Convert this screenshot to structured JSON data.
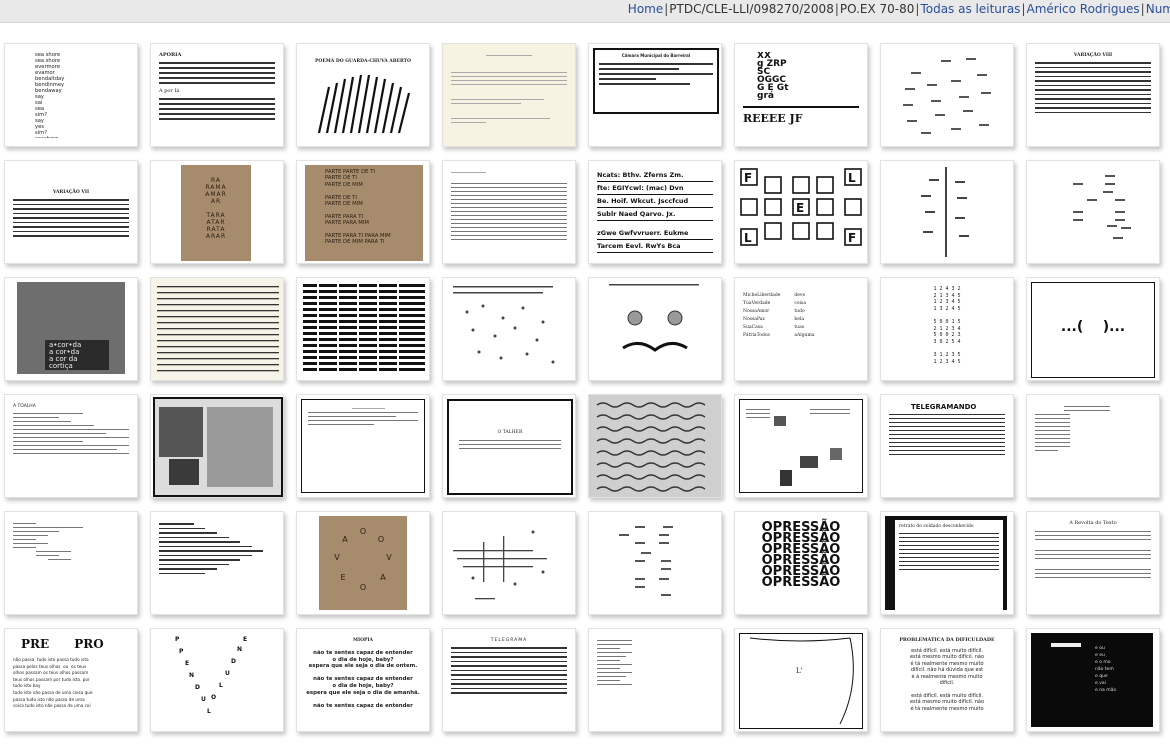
{
  "breadcrumb": {
    "home": "Home",
    "project": "PTDC/CLE-LLI/098270/2008",
    "section": "PO.EX 70-80",
    "all_readings": "Todas as leituras",
    "author": "Américo Rodrigues",
    "more": "Num"
  },
  "thumbs": {
    "t1": "sea shore\nsea shore\nevermore\nevamor\nbendaltday\nbendinmey\nbendaway\nsay\nsai\nsea\nsim?\nsay\nyes\nsim?\nseashore",
    "t2_title": "APORIA",
    "t2_sub": "A por Iá",
    "t3_title": "POEMA DO GUARDA-CHUVA ABERTO",
    "t5_title": "Câmara Municipal do Barreiral",
    "t6_letters": "XX\ng ZRP\nSC\nOGGC\nG E Gt\ngrá",
    "t6_bottom": "REEEE JF",
    "t8_title": "VARIAÇÃO VIII",
    "t9_title": "VARIAÇÃO VII",
    "t10_text": "RA\nRAMA\nAMAR\nAR\n\nTARA\nATAR\nRATA\nARAR",
    "t11_text": "PARTE PARTE DE TI\nPARTE DE TI\nPARTE DE MIM\n\nPARTE DE TI\nPARTE DE MIM\n\nPARTE PARA TI\nPARTE PARA MIM\n\nPARTE PARA TI PARA MIM\nPARTE DE MIM PARA TI",
    "t13_rows": [
      "Ncats: Bthv. Zferns Zm.",
      "fte: EGIYcwl: (mac) Dvn",
      "Be. Hoif. Wkcut. Jsccfcud",
      "Sublr Naed Qarvo. Jx.",
      "zGwe Gwfvvruerr. Eukme",
      "Tarcem Eevl. RwYs Bca"
    ],
    "t17_text": "a•cor•da\na cor•da\na cor da\ncortiça",
    "t21_left": "MicheLiberdade\nTuaVerdade\nNossaAmor\nNossaPaz\nSuaCasa\nPátriaTodos",
    "t21_right": "deve\ncoisa\ntudo\nbela\ntuas\naAlguma",
    "t22_text": "1 2 4 3 2\n2 1 3 4 5\n1 2 3 4 5\n1 3 2 4 5\n\n5 0 0 1 5\n2 1 2 3 4\n5 0 0 2 3\n3 0 2 5 4\n\n3 1 2 3 5\n1 2 3 4 5",
    "t23_text": "...(    )...",
    "t24_title": "A TOALHA",
    "t30_title": "TELEGRAMANDO",
    "t35_title": "O TALHER",
    "t37_text": "OPRESSÃO\nOPRESSÃO\nOPRESSÃO\nOPRESSÃO\nOPRESSÃO\nOPRESSÃO",
    "t38_title": "retrato do soldado desconhecido",
    "t40_title": "A Revolta do Texto",
    "t41_title": "PRE      PRO",
    "t41_text": "não passa  tudo isto passa tudo isto\npassa pelos teus olhos  ou  os teus\nolhos passam os teus olhos passam\nteus olhos passam por tudo isto. por\ntudo isto bay\ntudo isto não passa de uma coisa que\npassa tudo isto não passa de uma\ncoisa tudo isto não passa de uma coi",
    "t43_title": "MIOPIA",
    "t43_text": "não te sentes capaz de entender\no dia de hoje, baby?\nespera que ele seja o dia de ontem.\n\nnão te sentes capaz de entender\no dia de hoje, baby?\nespera que ele seja o dia de amanhã.\n\nnão te sentes capaz de entender",
    "t44_title": "TELEGRAMA",
    "t46_text": "L'",
    "t47_title": "PROBLEMÁTICA DA DIFICULDADE",
    "t47_text": "está difícil. está muito difícil.\nestá mesmo muito difícil. não\né tá realmente mesmo muito\ndifícil. não há dúvida que est\né á realmente mesmo muito\ndifícil.\n\nestá difícil. está muito difícil.\nestá mesmo muito difícil. não\né tá realmente mesmo muito",
    "t48_text": "e ou\ne eu\ne o mo\nnão tem\ne que\ne vai\ne na mão"
  }
}
